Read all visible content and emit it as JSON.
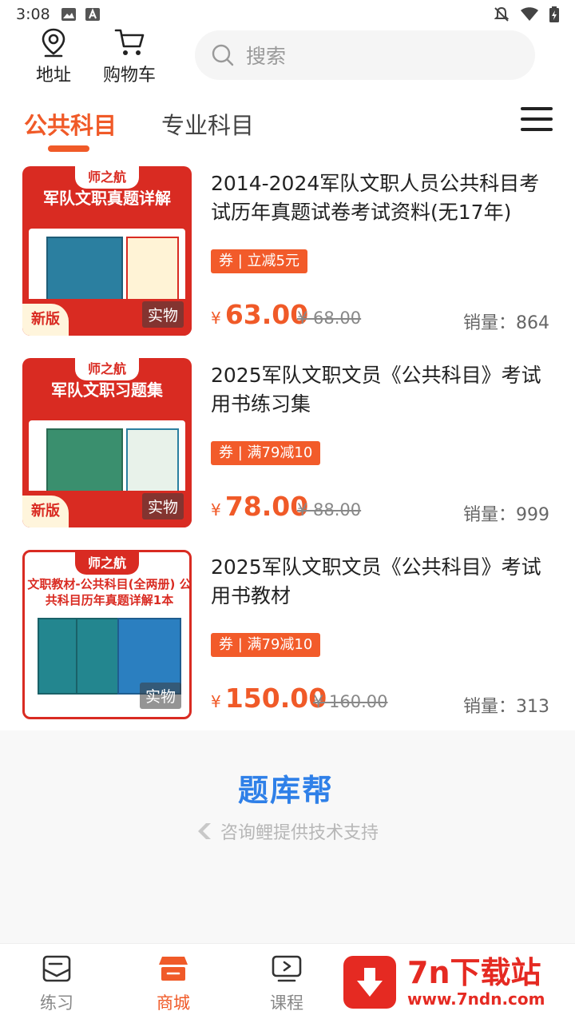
{
  "status_bar": {
    "time": "3:08",
    "icons": [
      "image-icon",
      "text-a-icon",
      "mute-bell-icon",
      "wifi-icon",
      "battery-charging-icon"
    ]
  },
  "top_bar": {
    "address_label": "地址",
    "cart_label": "购物车",
    "search_placeholder": "搜索"
  },
  "tabs": [
    {
      "label": "公共科目",
      "active": true
    },
    {
      "label": "专业科目",
      "active": false
    }
  ],
  "products": [
    {
      "thumb_brand": "师之航",
      "thumb_headline": "军队文职真题详解",
      "thumb_new": "新版",
      "thumb_badge": "实物",
      "title": "2014-2024军队文职人员公共科目考试历年真题试卷考试资料(无17年)",
      "coupon": "券 | 立减5元",
      "currency": "¥",
      "price": "63.00",
      "old_price": "¥ 68.00",
      "sales": "销量：864"
    },
    {
      "thumb_brand": "师之航",
      "thumb_headline": "军队文职习题集",
      "thumb_new": "新版",
      "thumb_badge": "实物",
      "title": "2025军队文职文员《公共科目》考试用书练习集",
      "coupon": "券 | 满79减10",
      "currency": "¥",
      "price": "78.00",
      "old_price": "¥ 88.00",
      "sales": "销量：999"
    },
    {
      "thumb_brand": "师之航",
      "thumb_headline": "文职教材-公共科目(全两册) 公共科目历年真题详解1本",
      "thumb_new": "",
      "thumb_badge": "实物",
      "title": "2025军队文职文员《公共科目》考试用书教材",
      "coupon": "券 | 满79减10",
      "currency": "¥",
      "price": "150.00",
      "old_price": "¥ 160.00",
      "sales": "销量：313"
    }
  ],
  "footer": {
    "logo_text": "题库帮",
    "support_text": "咨询鲤提供技术支持"
  },
  "bottom_nav": [
    {
      "label": "练习",
      "icon": "practice-icon",
      "active": false
    },
    {
      "label": "商城",
      "icon": "store-icon",
      "active": true
    },
    {
      "label": "课程",
      "icon": "course-play-icon",
      "active": false
    }
  ],
  "watermark": {
    "title": "7n下载站",
    "url": "www.7ndn.com"
  },
  "colors": {
    "accent": "#f05a28",
    "thumb_red": "#d92b22",
    "logo_blue": "#2f80e8"
  }
}
